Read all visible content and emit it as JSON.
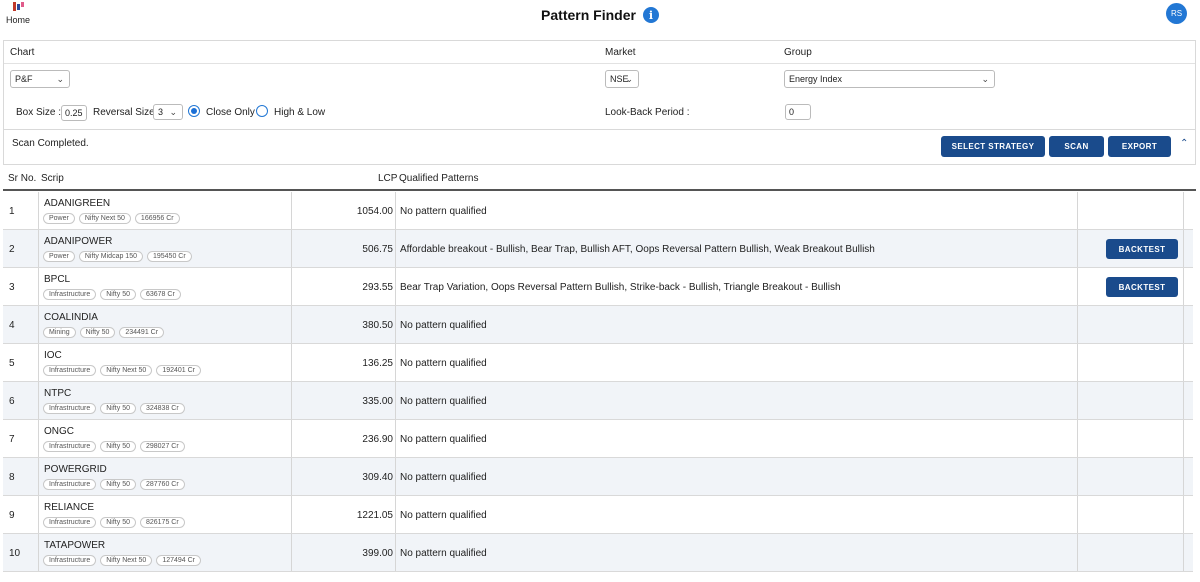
{
  "header": {
    "home_label": "Home",
    "title": "Pattern Finder",
    "info_glyph": "i",
    "avatar_initials": "RS",
    "brand_color": "#1a4b8c",
    "accent_color": "#2277d4"
  },
  "filters": {
    "chart_label": "Chart",
    "market_label": "Market",
    "group_label": "Group",
    "chart_value": "P&F",
    "market_value": "NSE",
    "group_value": "Energy Index",
    "box_size_label": "Box Size :",
    "box_size_value": "0.25",
    "reversal_label": "Reversal Size:",
    "reversal_value": "3",
    "close_only_label": "Close Only",
    "high_low_label": "High & Low",
    "selected_mode": "Close Only",
    "lookback_label": "Look-Back Period :",
    "lookback_value": "0"
  },
  "actions": {
    "status_text": "Scan Completed.",
    "select_strategy_label": "SELECT STRATEGY",
    "scan_label": "SCAN",
    "export_label": "EXPORT",
    "collapse_icon": "chevron-up-icon"
  },
  "table": {
    "columns": [
      "Sr No.",
      "Scrip",
      "LCP",
      "Qualified Patterns"
    ],
    "backtest_label": "BACKTEST",
    "rows": [
      {
        "sr": "1",
        "scrip": "ADANIGREEN",
        "tags": [
          "Power",
          "Nifty Next 50",
          "166956 Cr"
        ],
        "lcp": "1054.00",
        "patterns": "No pattern qualified",
        "backtest": false
      },
      {
        "sr": "2",
        "scrip": "ADANIPOWER",
        "tags": [
          "Power",
          "Nifty Midcap 150",
          "195450 Cr"
        ],
        "lcp": "506.75",
        "patterns": "Affordable breakout - Bullish, Bear Trap, Bullish AFT, Oops Reversal Pattern Bullish, Weak Breakout Bullish",
        "backtest": true
      },
      {
        "sr": "3",
        "scrip": "BPCL",
        "tags": [
          "Infrastructure",
          "Nifty 50",
          "63678 Cr"
        ],
        "lcp": "293.55",
        "patterns": "Bear Trap Variation, Oops Reversal Pattern Bullish, Strike-back - Bullish, Triangle Breakout - Bullish",
        "backtest": true
      },
      {
        "sr": "4",
        "scrip": "COALINDIA",
        "tags": [
          "Mining",
          "Nifty 50",
          "234491 Cr"
        ],
        "lcp": "380.50",
        "patterns": "No pattern qualified",
        "backtest": false
      },
      {
        "sr": "5",
        "scrip": "IOC",
        "tags": [
          "Infrastructure",
          "Nifty Next 50",
          "192401 Cr"
        ],
        "lcp": "136.25",
        "patterns": "No pattern qualified",
        "backtest": false
      },
      {
        "sr": "6",
        "scrip": "NTPC",
        "tags": [
          "Infrastructure",
          "Nifty 50",
          "324838 Cr"
        ],
        "lcp": "335.00",
        "patterns": "No pattern qualified",
        "backtest": false
      },
      {
        "sr": "7",
        "scrip": "ONGC",
        "tags": [
          "Infrastructure",
          "Nifty 50",
          "298027 Cr"
        ],
        "lcp": "236.90",
        "patterns": "No pattern qualified",
        "backtest": false
      },
      {
        "sr": "8",
        "scrip": "POWERGRID",
        "tags": [
          "Infrastructure",
          "Nifty 50",
          "287760 Cr"
        ],
        "lcp": "309.40",
        "patterns": "No pattern qualified",
        "backtest": false
      },
      {
        "sr": "9",
        "scrip": "RELIANCE",
        "tags": [
          "Infrastructure",
          "Nifty 50",
          "826175 Cr"
        ],
        "lcp": "1221.05",
        "patterns": "No pattern qualified",
        "backtest": false
      },
      {
        "sr": "10",
        "scrip": "TATAPOWER",
        "tags": [
          "Infrastructure",
          "Nifty Next 50",
          "127494 Cr"
        ],
        "lcp": "399.00",
        "patterns": "No pattern qualified",
        "backtest": false
      }
    ]
  }
}
